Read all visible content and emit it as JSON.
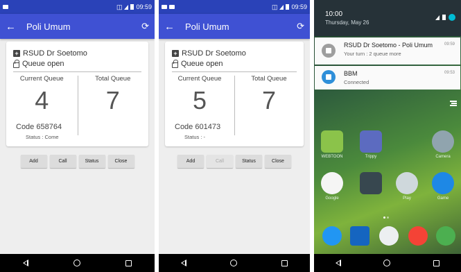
{
  "status_bar": {
    "time": "09:59"
  },
  "screens": [
    {
      "app_title": "Poli Umum",
      "hospital": "RSUD Dr Soetomo",
      "queue_state": "Queue open",
      "current_label": "Current Queue",
      "current_value": "4",
      "total_label": "Total Queue",
      "total_value": "7",
      "code": "Code 658764",
      "status": "Status : Come",
      "buttons": [
        "Add",
        "Call",
        "Status",
        "Close"
      ]
    },
    {
      "app_title": "Poli Umum",
      "hospital": "RSUD Dr Soetomo",
      "queue_state": "Queue open",
      "current_label": "Current Queue",
      "current_value": "5",
      "total_label": "Total Queue",
      "total_value": "7",
      "code": "Code 601473",
      "status": "Status : -",
      "buttons": [
        "Add",
        "Call",
        "Status",
        "Close"
      ]
    }
  ],
  "shade": {
    "time": "10:00",
    "date": "Thursday, May 26",
    "notifications": [
      {
        "title": "RSUD Dr Soetomo - Poli Umum",
        "text": "Your turn : 2 queue more",
        "time": "09:59",
        "icon": "app-icon"
      },
      {
        "title": "BBM",
        "text": "Connected",
        "time": "09:53",
        "icon": "bbm-icon"
      }
    ]
  },
  "home_apps": [
    {
      "label": "WEBTOON",
      "color": "#8bc34a"
    },
    {
      "label": "Trippy",
      "color": "#5c6bc0"
    },
    {
      "label": "Camera",
      "color": "#90a4ae"
    },
    {
      "label": "Google",
      "color": "#f5f5f5"
    },
    {
      "label": "",
      "color": "#37474f"
    },
    {
      "label": "Play",
      "color": "#cfd8dc"
    },
    {
      "label": "Game",
      "color": "#1e88e5"
    }
  ],
  "dock_apps": [
    {
      "name": "phone-icon",
      "color": "#2196f3"
    },
    {
      "name": "messages-icon",
      "color": "#1565c0"
    },
    {
      "name": "apps-drawer-icon",
      "color": "#eceff1"
    },
    {
      "name": "chrome-icon",
      "color": "#f44336"
    },
    {
      "name": "whatsapp-icon",
      "color": "#4caf50"
    }
  ],
  "colors": {
    "primary": "#3f51d3",
    "status": "#2a42b8"
  }
}
